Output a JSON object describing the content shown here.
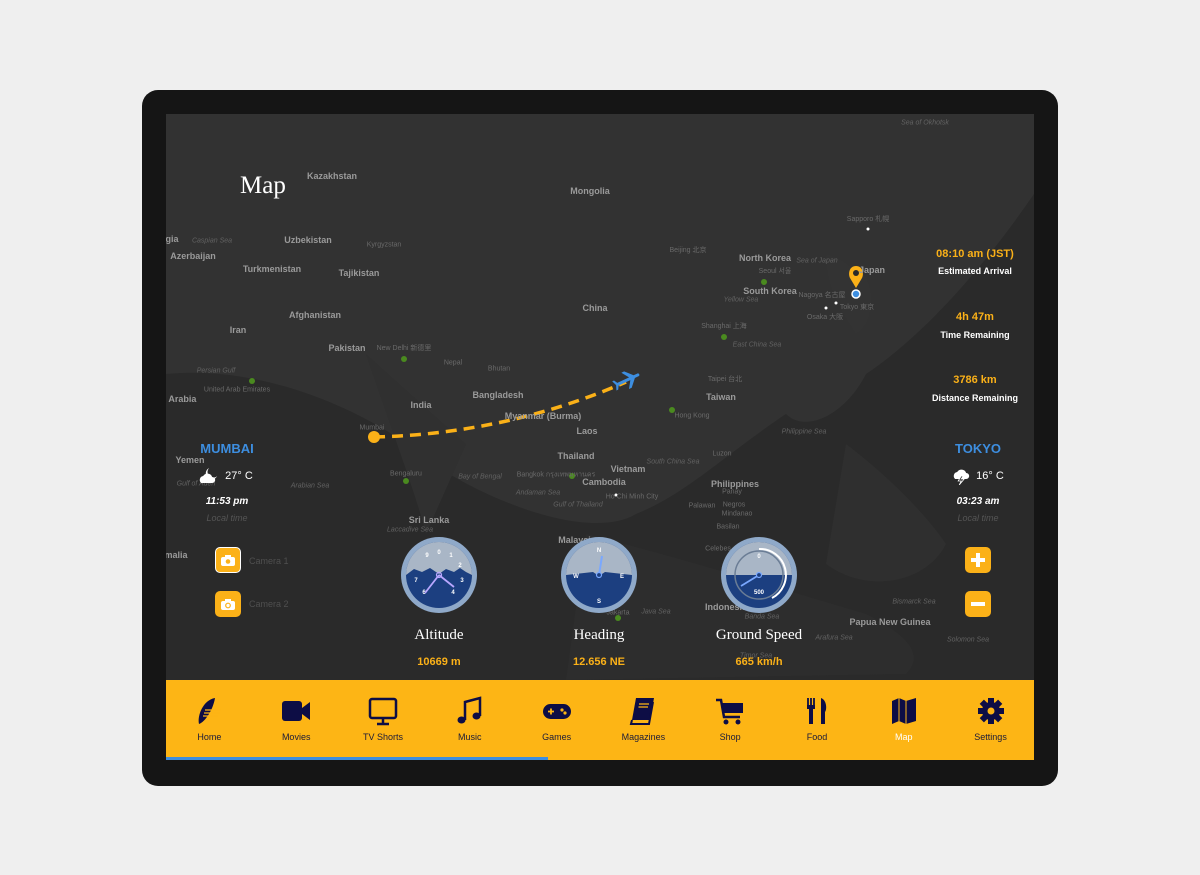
{
  "page": {
    "title": "Map"
  },
  "map": {
    "labels": [
      "Kazakhstan",
      "Mongolia",
      "Uzbekistan",
      "Kyrgyzstan",
      "Caspian Sea",
      "Azerbaijan",
      "Turkmenistan",
      "Tajikistan",
      "Afghanistan",
      "Iran",
      "Pakistan",
      "New Delhi\n新德里",
      "Nepal",
      "Bhutan",
      "China",
      "Beijing 北京",
      "North Korea",
      "Sea of Japan",
      "Seoul 서울",
      "South Korea",
      "Yellow Sea",
      "Japan",
      "Nagoya 名古屋",
      "Osaka 大阪",
      "Tokyo 東京",
      "Sapporo 札幌",
      "Shanghai 上海",
      "East China Sea",
      "Taipei 台北",
      "Taiwan",
      "Hong Kong",
      "Philippine Sea",
      "Bangladesh",
      "Myanmar (Burma)",
      "India",
      "Mumbai",
      "Laos",
      "Thailand",
      "Vietnam",
      "South China Sea",
      "Luzon",
      "Bangkok กรุงเทพมหานคร",
      "Cambodia",
      "Ho Chi Minh City",
      "Philippines",
      "Panay",
      "Negros",
      "Mindanao",
      "Palawan",
      "Basilan",
      "Andaman Sea",
      "Gulf of Thailand",
      "Bay of Bengal",
      "Bengaluru",
      "Sri Lanka",
      "Laccadive Sea",
      "Arabian Sea",
      "Persian Gulf",
      "United Arab Emirates",
      "i Arabia",
      "Yemen",
      "Gulf of Aden",
      "malia",
      "Malaysia",
      "Jakarta",
      "Java Sea",
      "Celebes",
      "Indonesia",
      "Banda Sea",
      "Bismarck Sea",
      "Papua New Guinea",
      "Arafura Sea",
      "Timor Sea",
      "Solomon Sea",
      "Sea of Okhotsk",
      "gia"
    ]
  },
  "origin": {
    "city": "MUMBAI",
    "weather_icon": "partly-cloudy-night-icon",
    "temp": "27° C",
    "time": "11:53 pm",
    "time_label": "Local time"
  },
  "destination": {
    "city": "TOKYO",
    "weather_icon": "thunderstorm-icon",
    "temp": "16° C",
    "time": "03:23 am",
    "time_label": "Local time"
  },
  "flight": {
    "arrival": "08:10 am (JST)",
    "arrival_label": "Estimated Arrival",
    "time_remaining": "4h 47m",
    "time_remaining_label": "Time Remaining",
    "distance": "3786 km",
    "distance_label": "Distance Remaining",
    "progress_percent": 44
  },
  "cameras": [
    {
      "label": "Camera 1"
    },
    {
      "label": "Camera 2"
    }
  ],
  "gauges": [
    {
      "label": "Altitude",
      "value": "10669 m"
    },
    {
      "label": "Heading",
      "value": "12.656 NE"
    },
    {
      "label": "Ground Speed",
      "value": "665 km/h",
      "dial": "500",
      "dial_zero": "0"
    }
  ],
  "compass": {
    "n": "N",
    "e": "E",
    "s": "S",
    "w": "W"
  },
  "nav": [
    {
      "label": "Home",
      "icon": "home-logo-icon"
    },
    {
      "label": "Movies",
      "icon": "video-camera-icon"
    },
    {
      "label": "TV Shorts",
      "icon": "tv-icon"
    },
    {
      "label": "Music",
      "icon": "music-note-icon"
    },
    {
      "label": "Games",
      "icon": "gamepad-icon"
    },
    {
      "label": "Magazines",
      "icon": "book-icon"
    },
    {
      "label": "Shop",
      "icon": "cart-icon"
    },
    {
      "label": "Food",
      "icon": "fork-knife-icon"
    },
    {
      "label": "Map",
      "icon": "map-icon",
      "active": true
    },
    {
      "label": "Settings",
      "icon": "gear-icon"
    }
  ],
  "colors": {
    "accent": "#fdb515",
    "city": "#3d8ee0",
    "nav_text": "#1a1a3a",
    "gauge": "#1c3f80"
  }
}
